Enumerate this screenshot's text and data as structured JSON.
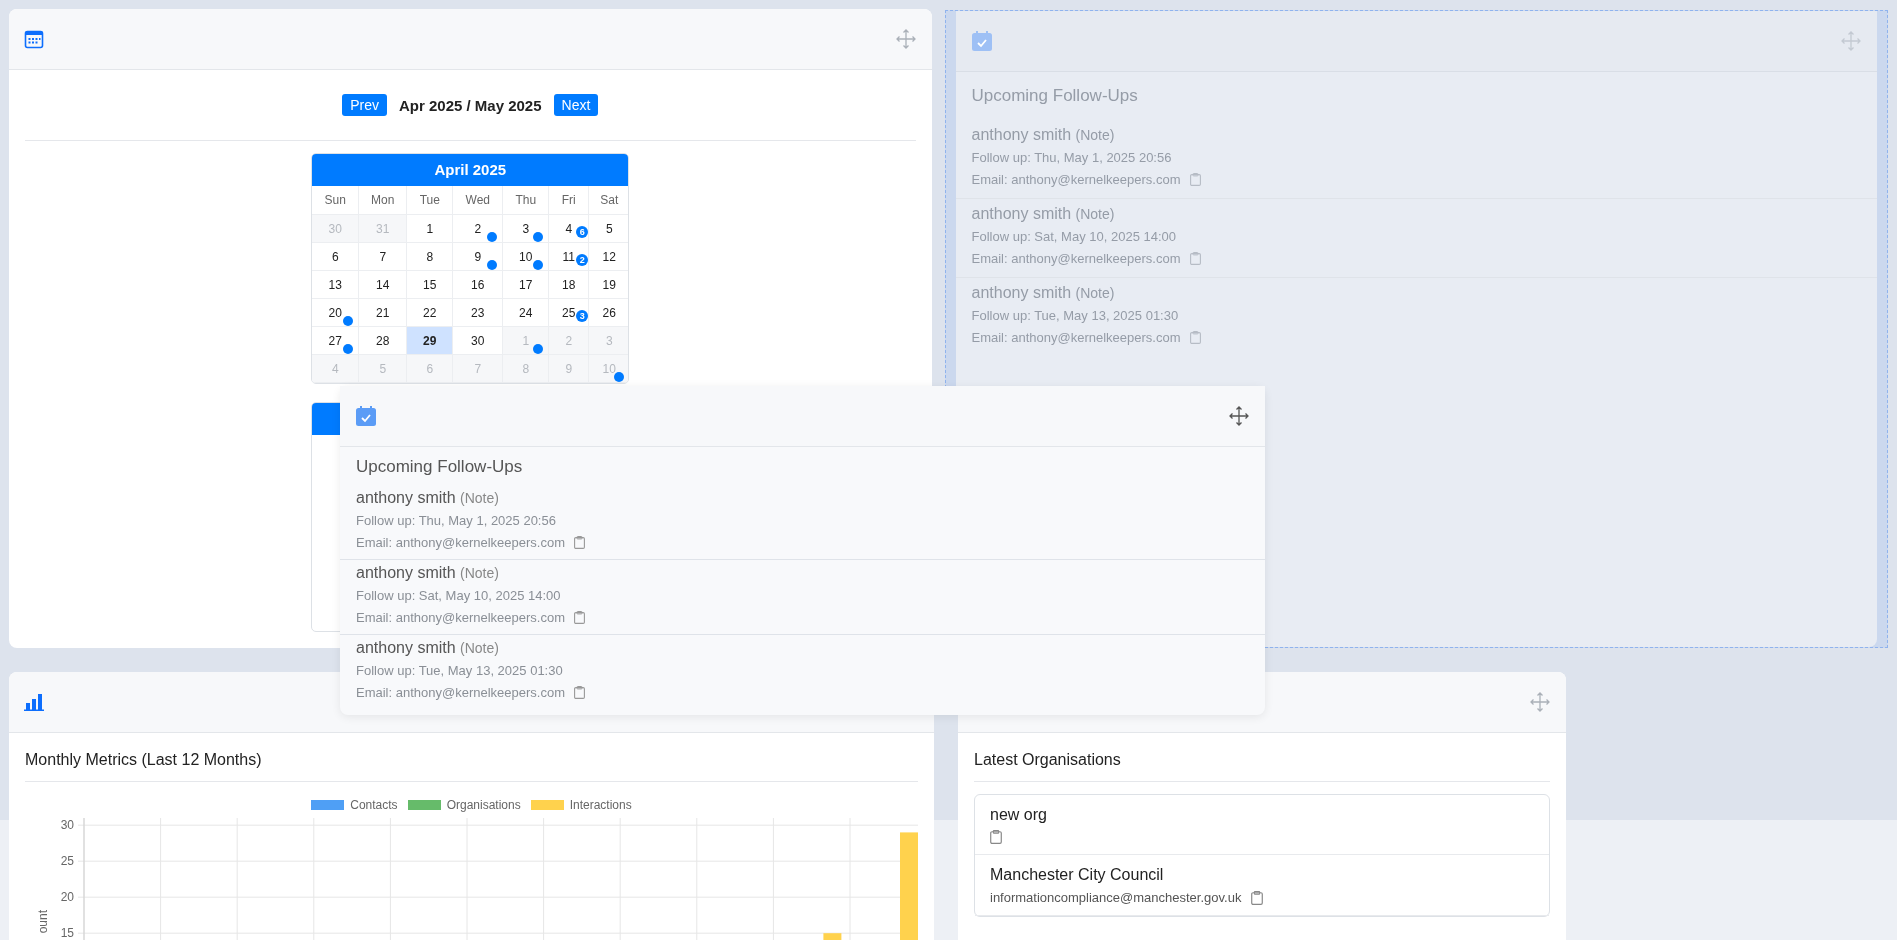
{
  "calendar": {
    "prev": "Prev",
    "title": "Apr 2025 / May 2025",
    "next": "Next",
    "months": [
      {
        "title": "April 2025",
        "weekdays": [
          "Sun",
          "Mon",
          "Tue",
          "Wed",
          "Thu",
          "Fri",
          "Sat"
        ],
        "weeks": [
          [
            {
              "day": "30",
              "outside": true,
              "today": false
            },
            {
              "day": "31",
              "outside": true,
              "today": false
            },
            {
              "day": "1",
              "outside": false,
              "today": false
            },
            {
              "day": "2",
              "outside": false,
              "today": false,
              "marker": {
                "kind": "dot"
              }
            },
            {
              "day": "3",
              "outside": false,
              "today": false,
              "marker": {
                "kind": "dot"
              }
            },
            {
              "day": "4",
              "outside": false,
              "today": false,
              "marker": {
                "kind": "count",
                "count": "6"
              }
            },
            {
              "day": "5",
              "outside": false,
              "today": false
            }
          ],
          [
            {
              "day": "6",
              "outside": false,
              "today": false
            },
            {
              "day": "7",
              "outside": false,
              "today": false
            },
            {
              "day": "8",
              "outside": false,
              "today": false
            },
            {
              "day": "9",
              "outside": false,
              "today": false,
              "marker": {
                "kind": "dot"
              }
            },
            {
              "day": "10",
              "outside": false,
              "today": false,
              "marker": {
                "kind": "dot"
              }
            },
            {
              "day": "11",
              "outside": false,
              "today": false,
              "marker": {
                "kind": "count",
                "count": "2"
              }
            },
            {
              "day": "12",
              "outside": false,
              "today": false
            }
          ],
          [
            {
              "day": "13",
              "outside": false,
              "today": false
            },
            {
              "day": "14",
              "outside": false,
              "today": false
            },
            {
              "day": "15",
              "outside": false,
              "today": false
            },
            {
              "day": "16",
              "outside": false,
              "today": false
            },
            {
              "day": "17",
              "outside": false,
              "today": false
            },
            {
              "day": "18",
              "outside": false,
              "today": false
            },
            {
              "day": "19",
              "outside": false,
              "today": false
            }
          ],
          [
            {
              "day": "20",
              "outside": false,
              "today": false,
              "marker": {
                "kind": "dot"
              }
            },
            {
              "day": "21",
              "outside": false,
              "today": false
            },
            {
              "day": "22",
              "outside": false,
              "today": false
            },
            {
              "day": "23",
              "outside": false,
              "today": false
            },
            {
              "day": "24",
              "outside": false,
              "today": false
            },
            {
              "day": "25",
              "outside": false,
              "today": false,
              "marker": {
                "kind": "count",
                "count": "3"
              }
            },
            {
              "day": "26",
              "outside": false,
              "today": false
            }
          ],
          [
            {
              "day": "27",
              "outside": false,
              "today": false,
              "marker": {
                "kind": "dot"
              }
            },
            {
              "day": "28",
              "outside": false,
              "today": false
            },
            {
              "day": "29",
              "outside": false,
              "today": true
            },
            {
              "day": "30",
              "outside": false,
              "today": false
            },
            {
              "day": "1",
              "outside": true,
              "today": false,
              "marker": {
                "kind": "dot"
              }
            },
            {
              "day": "2",
              "outside": true,
              "today": false
            },
            {
              "day": "3",
              "outside": true,
              "today": false
            }
          ],
          [
            {
              "day": "4",
              "outside": true,
              "today": false
            },
            {
              "day": "5",
              "outside": true,
              "today": false
            },
            {
              "day": "6",
              "outside": true,
              "today": false
            },
            {
              "day": "7",
              "outside": true,
              "today": false
            },
            {
              "day": "8",
              "outside": true,
              "today": false
            },
            {
              "day": "9",
              "outside": true,
              "today": false
            },
            {
              "day": "10",
              "outside": true,
              "today": false,
              "marker": {
                "kind": "dot"
              }
            }
          ]
        ]
      }
    ]
  },
  "follow_up_placeholder": {
    "title": "Upcoming Follow-Ups",
    "items": [
      {
        "name": "anthony smith",
        "type": "(Note)",
        "follow_up": "Follow up: Thu, May 1, 2025 20:56",
        "email": "Email: anthony@kernelkeepers.com"
      },
      {
        "name": "anthony smith",
        "type": "(Note)",
        "follow_up": "Follow up: Sat, May 10, 2025 14:00",
        "email": "Email: anthony@kernelkeepers.com"
      },
      {
        "name": "anthony smith",
        "type": "(Note)",
        "follow_up": "Follow up: Tue, May 13, 2025 01:30",
        "email": "Email: anthony@kernelkeepers.com"
      }
    ]
  },
  "dragged_follow_ups": {
    "title": "Upcoming Follow-Ups",
    "items": [
      {
        "name": "anthony smith",
        "type": "(Note)",
        "follow_up": "Follow up: Thu, May 1, 2025 20:56",
        "email": "Email: anthony@kernelkeepers.com"
      },
      {
        "name": "anthony smith",
        "type": "(Note)",
        "follow_up": "Follow up: Sat, May 10, 2025 14:00",
        "email": "Email: anthony@kernelkeepers.com"
      },
      {
        "name": "anthony smith",
        "type": "(Note)",
        "follow_up": "Follow up: Tue, May 13, 2025 01:30",
        "email": "Email: anthony@kernelkeepers.com"
      }
    ]
  },
  "metrics": {
    "title": "Monthly Metrics (Last 12 Months)",
    "chart_data": {
      "type": "bar",
      "ylabel": "ount",
      "ylim": [
        14,
        31
      ],
      "grid": true,
      "yticks": [
        15,
        20,
        25,
        30
      ],
      "series": [
        {
          "name": "Contacts",
          "color": "#4f9ff5",
          "values": [
            null,
            null,
            null,
            null,
            null,
            null,
            null,
            null,
            null,
            null,
            null
          ]
        },
        {
          "name": "Organisations",
          "color": "#66bb6a",
          "values": [
            null,
            null,
            null,
            null,
            null,
            null,
            null,
            null,
            null,
            null,
            null
          ]
        },
        {
          "name": "Interactions",
          "color": "#ffd24d",
          "values": [
            null,
            null,
            null,
            null,
            null,
            null,
            null,
            null,
            null,
            15,
            29
          ]
        }
      ]
    }
  },
  "organisations": {
    "title": "Latest Organisations",
    "items": [
      {
        "name": "new org"
      },
      {
        "name": "Manchester City Council",
        "email": "informationcompliance@manchester.gov.uk"
      }
    ]
  }
}
